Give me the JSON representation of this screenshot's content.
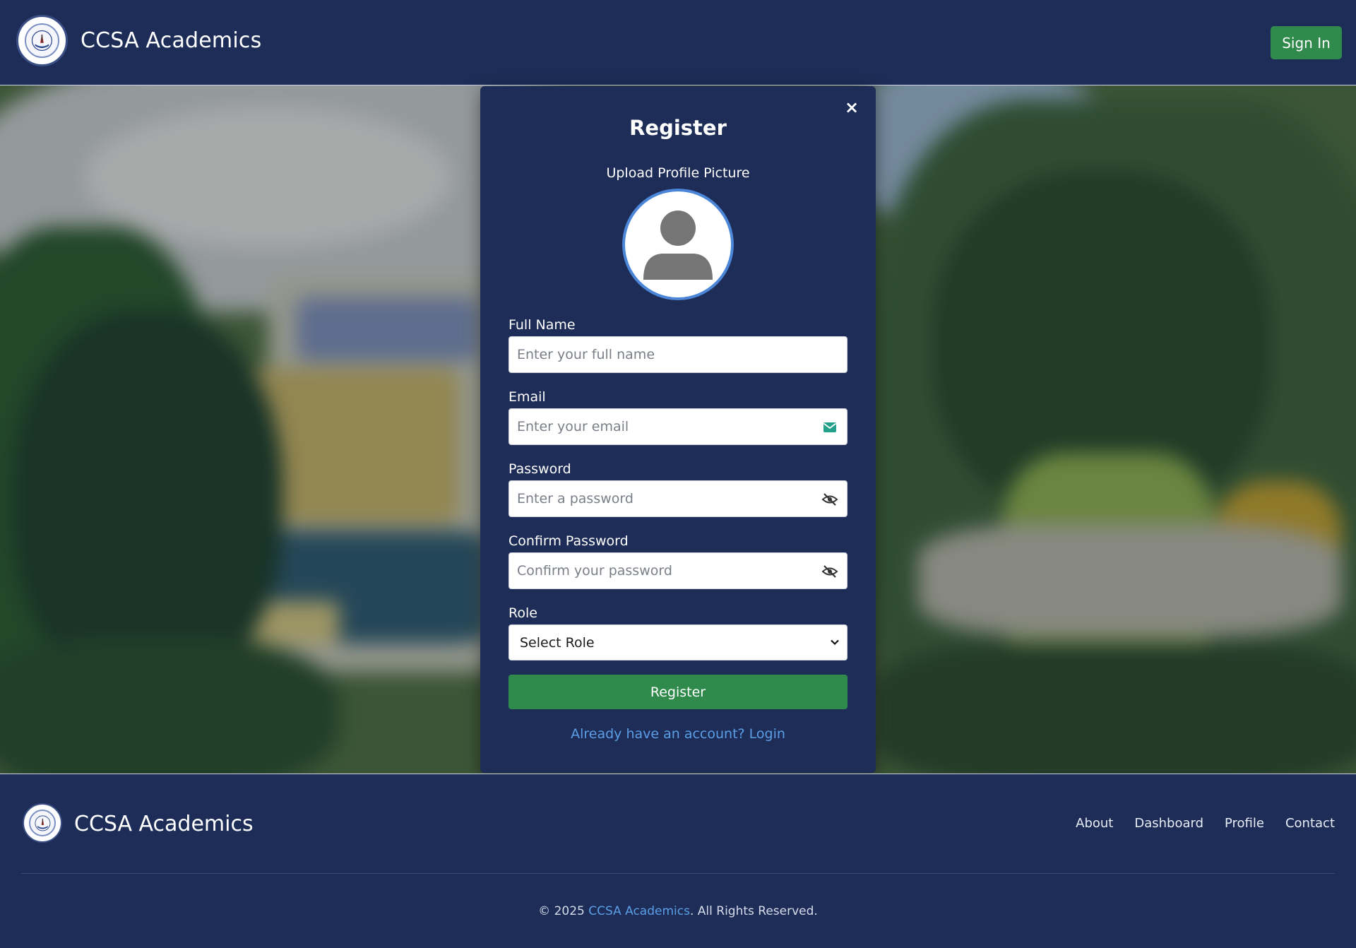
{
  "header": {
    "brand_title": "CCSA Academics",
    "sign_in_label": "Sign In"
  },
  "modal": {
    "close_glyph": "×",
    "title": "Register",
    "upload_label": "Upload Profile Picture",
    "fields": {
      "full_name": {
        "label": "Full Name",
        "placeholder": "Enter your full name"
      },
      "email": {
        "label": "Email",
        "placeholder": "Enter your email",
        "icon": "envelope-icon"
      },
      "password": {
        "label": "Password",
        "placeholder": "Enter a password",
        "icon": "eye-slash-icon"
      },
      "confirm_password": {
        "label": "Confirm Password",
        "placeholder": "Confirm your password",
        "icon": "eye-slash-icon"
      },
      "role": {
        "label": "Role",
        "value": "Select Role"
      }
    },
    "register_label": "Register",
    "login_link": "Already have an account? Login"
  },
  "footer": {
    "brand_title": "CCSA Academics",
    "nav": [
      "About",
      "Dashboard",
      "Profile",
      "Contact"
    ],
    "copyright_prefix": "© 2025",
    "copyright_brand": "CCSA Academics",
    "copyright_suffix": ". All Rights Reserved."
  },
  "colors": {
    "navy": "#1d2d57",
    "accent_green": "#2f8a4c",
    "link_blue": "#5b9ee6",
    "avatar_ring": "#4b86d8"
  }
}
